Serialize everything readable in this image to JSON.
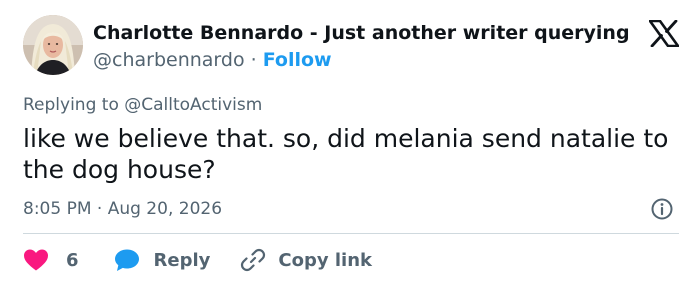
{
  "author": {
    "name": "Charlotte Bennardo - Just another writer querying",
    "handle": "@charbennardo",
    "separator": " · ",
    "follow_label": "Follow"
  },
  "brand": {
    "logo_icon": "x-logo-icon"
  },
  "tweet": {
    "replying_to": "Replying to @CalltoActivism",
    "text": "like we believe that. so, did melania send natalie to the dog house?",
    "timestamp": "8:05 PM · Aug 20, 2026"
  },
  "actions": {
    "like_count": "6",
    "reply_label": "Reply",
    "copy_link_label": "Copy link"
  },
  "colors": {
    "text": "#0f1419",
    "secondary": "#536471",
    "accent": "#1d9bf0",
    "like": "#f91880",
    "divider": "#cfd9de"
  }
}
